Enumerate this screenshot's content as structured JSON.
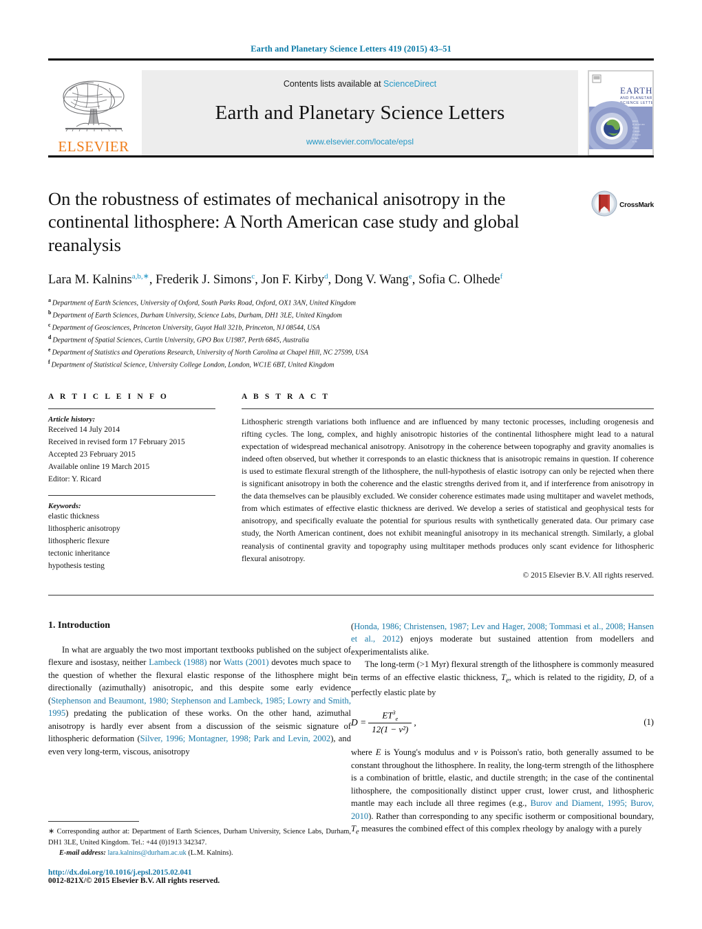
{
  "running_head": "Earth and Planetary Science Letters 419 (2015) 43–51",
  "header": {
    "contents_prefix": "Contents lists available at ",
    "sciencedirect": "ScienceDirect",
    "journal_title": "Earth and Planetary Science Letters",
    "journal_url": "www.elsevier.com/locate/epsl",
    "publisher_logo_text": "ELSEVIER",
    "publisher_logo_icon": "elsevier-tree-icon",
    "cover_title_line1": "EARTH",
    "cover_title_line2": "AND PLANETARY",
    "cover_title_line3": "SCIENCE LETTERS",
    "link_color": "#2196c4"
  },
  "crossmark": {
    "label": "CrossMark",
    "icon": "crossmark-icon"
  },
  "title": "On the robustness of estimates of mechanical anisotropy in the continental lithosphere: A North American case study and global reanalysis",
  "authors": [
    {
      "name": "Lara M. Kalnins",
      "marks": "a,b,∗"
    },
    {
      "name": "Frederik J. Simons",
      "marks": "c"
    },
    {
      "name": "Jon F. Kirby",
      "marks": "d"
    },
    {
      "name": "Dong V. Wang",
      "marks": "e"
    },
    {
      "name": "Sofia C. Olhede",
      "marks": "f"
    }
  ],
  "affiliations": [
    {
      "mark": "a",
      "text": "Department of Earth Sciences, University of Oxford, South Parks Road, Oxford, OX1 3AN, United Kingdom"
    },
    {
      "mark": "b",
      "text": "Department of Earth Sciences, Durham University, Science Labs, Durham, DH1 3LE, United Kingdom"
    },
    {
      "mark": "c",
      "text": "Department of Geosciences, Princeton University, Guyot Hall 321b, Princeton, NJ 08544, USA"
    },
    {
      "mark": "d",
      "text": "Department of Spatial Sciences, Curtin University, GPO Box U1987, Perth 6845, Australia"
    },
    {
      "mark": "e",
      "text": "Department of Statistics and Operations Research, University of North Carolina at Chapel Hill, NC 27599, USA"
    },
    {
      "mark": "f",
      "text": "Department of Statistical Science, University College London, London, WC1E 6BT, United Kingdom"
    }
  ],
  "article_info": {
    "heading": "A R T I C L E   I N F O",
    "history_label": "Article history:",
    "history": [
      "Received 14 July 2014",
      "Received in revised form 17 February 2015",
      "Accepted 23 February 2015",
      "Available online 19 March 2015",
      "Editor: Y. Ricard"
    ],
    "keywords_label": "Keywords:",
    "keywords": [
      "elastic thickness",
      "lithospheric anisotropy",
      "lithospheric flexure",
      "tectonic inheritance",
      "hypothesis testing"
    ]
  },
  "abstract": {
    "heading": "A B S T R A C T",
    "text": "Lithospheric strength variations both influence and are influenced by many tectonic processes, including orogenesis and rifting cycles. The long, complex, and highly anisotropic histories of the continental lithosphere might lead to a natural expectation of widespread mechanical anisotropy. Anisotropy in the coherence between topography and gravity anomalies is indeed often observed, but whether it corresponds to an elastic thickness that is anisotropic remains in question. If coherence is used to estimate flexural strength of the lithosphere, the null-hypothesis of elastic isotropy can only be rejected when there is significant anisotropy in both the coherence and the elastic strengths derived from it, and if interference from anisotropy in the data themselves can be plausibly excluded. We consider coherence estimates made using multitaper and wavelet methods, from which estimates of effective elastic thickness are derived. We develop a series of statistical and geophysical tests for anisotropy, and specifically evaluate the potential for spurious results with synthetically generated data. Our primary case study, the North American continent, does not exhibit meaningful anisotropy in its mechanical strength. Similarly, a global reanalysis of continental gravity and topography using multitaper methods produces only scant evidence for lithospheric flexural anisotropy.",
    "copyright": "© 2015 Elsevier B.V. All rights reserved."
  },
  "body": {
    "section_number_title": "1. Introduction",
    "left_paragraph_parts": [
      {
        "t": "In what are arguably the two most important textbooks pub­lished on the subject of flexure and isostasy, neither ",
        "link": false
      },
      {
        "t": "Lambeck (1988)",
        "link": true
      },
      {
        "t": " nor ",
        "link": false
      },
      {
        "t": "Watts (2001)",
        "link": true
      },
      {
        "t": " devotes much space to the question of whether the flexural elastic response of the lithosphere might be directionally (azimuthally) anisotropic, and this despite some early evidence (",
        "link": false
      },
      {
        "t": "Stephenson and Beaumont, 1980; Stephenson and Lambeck, 1985; Lowry and Smith, 1995",
        "link": true
      },
      {
        "t": ") predating the publica­tion of these works. On the other hand, azimuthal anisotropy is hardly ever absent from a discussion of the seismic signa­ture of lithospheric deformation (",
        "link": false
      },
      {
        "t": "Silver, 1996; Montagner, 1998; Park and Levin, 2002",
        "link": true
      },
      {
        "t": "), and even very long-term, viscous, anisotropy",
        "link": false
      }
    ],
    "right_paragraph1_parts": [
      {
        "t": "(",
        "link": false
      },
      {
        "t": "Honda, 1986; Christensen, 1987; Lev and Hager, 2008; Tommasi et al., 2008; Hansen et al., 2012",
        "link": true
      },
      {
        "t": ") enjoys moderate but sustained at­tention from modellers and experimentalists alike.",
        "link": false
      }
    ],
    "right_paragraph2_parts": [
      {
        "t": "The long-term (>1 Myr) flexural strength of the lithosphere is commonly measured in terms of an effective elastic thickness, ",
        "link": false
      },
      {
        "t": "T",
        "link": false,
        "italic": true
      },
      {
        "t": ", which is related to the rigidity, ",
        "link": false
      },
      {
        "t": "D",
        "link": false,
        "italic": true
      },
      {
        "t": ", of a perfectly elastic plate by",
        "link": false
      }
    ],
    "equation": {
      "lhs": "D =",
      "numerator": "ET",
      "numerator_exp": "3",
      "numerator_sub": "e",
      "denominator": "12(1 − ν²)",
      "trailing_comma": ",",
      "number": "(1)"
    },
    "right_paragraph3_parts": [
      {
        "t": "where ",
        "link": false
      },
      {
        "t": "E",
        "link": false,
        "italic": true
      },
      {
        "t": " is Young's modulus and ",
        "link": false
      },
      {
        "t": "ν",
        "link": false,
        "italic": true
      },
      {
        "t": " is Poisson's ratio, both generally assumed to be constant throughout the lithosphere. In reality, the long-term strength of the lithosphere is a combination of brittle, elastic, and ductile strength; in the case of the continental litho­sphere, the compositionally distinct upper crust, lower crust, and lithospheric mantle may each include all three regimes (e.g., ",
        "link": false
      },
      {
        "t": "Burov and Diament, 1995; Burov, 2010",
        "link": true
      },
      {
        "t": "). Rather than corresponding to any specific isotherm or compositional boundary, ",
        "link": false
      },
      {
        "t": "T",
        "link": false,
        "italic": true
      },
      {
        "t": " measures the combined effect of this complex rheology by analogy with a purely",
        "link": false
      }
    ]
  },
  "footnotes": {
    "corresponding_star": "∗",
    "corresponding_text": "Corresponding author at: Department of Earth Sciences, Durham University, Science Labs, Durham, DH1 3LE, United Kingdom. Tel.: +44 (0)1913 342347.",
    "email_label": "E-mail address:",
    "email": "lara.kalnins@durham.ac.uk",
    "email_owner": "(L.M. Kalnins).",
    "doi": "http://dx.doi.org/10.1016/j.epsl.2015.02.041",
    "issn": "0012-821X/© 2015 Elsevier B.V. All rights reserved."
  }
}
